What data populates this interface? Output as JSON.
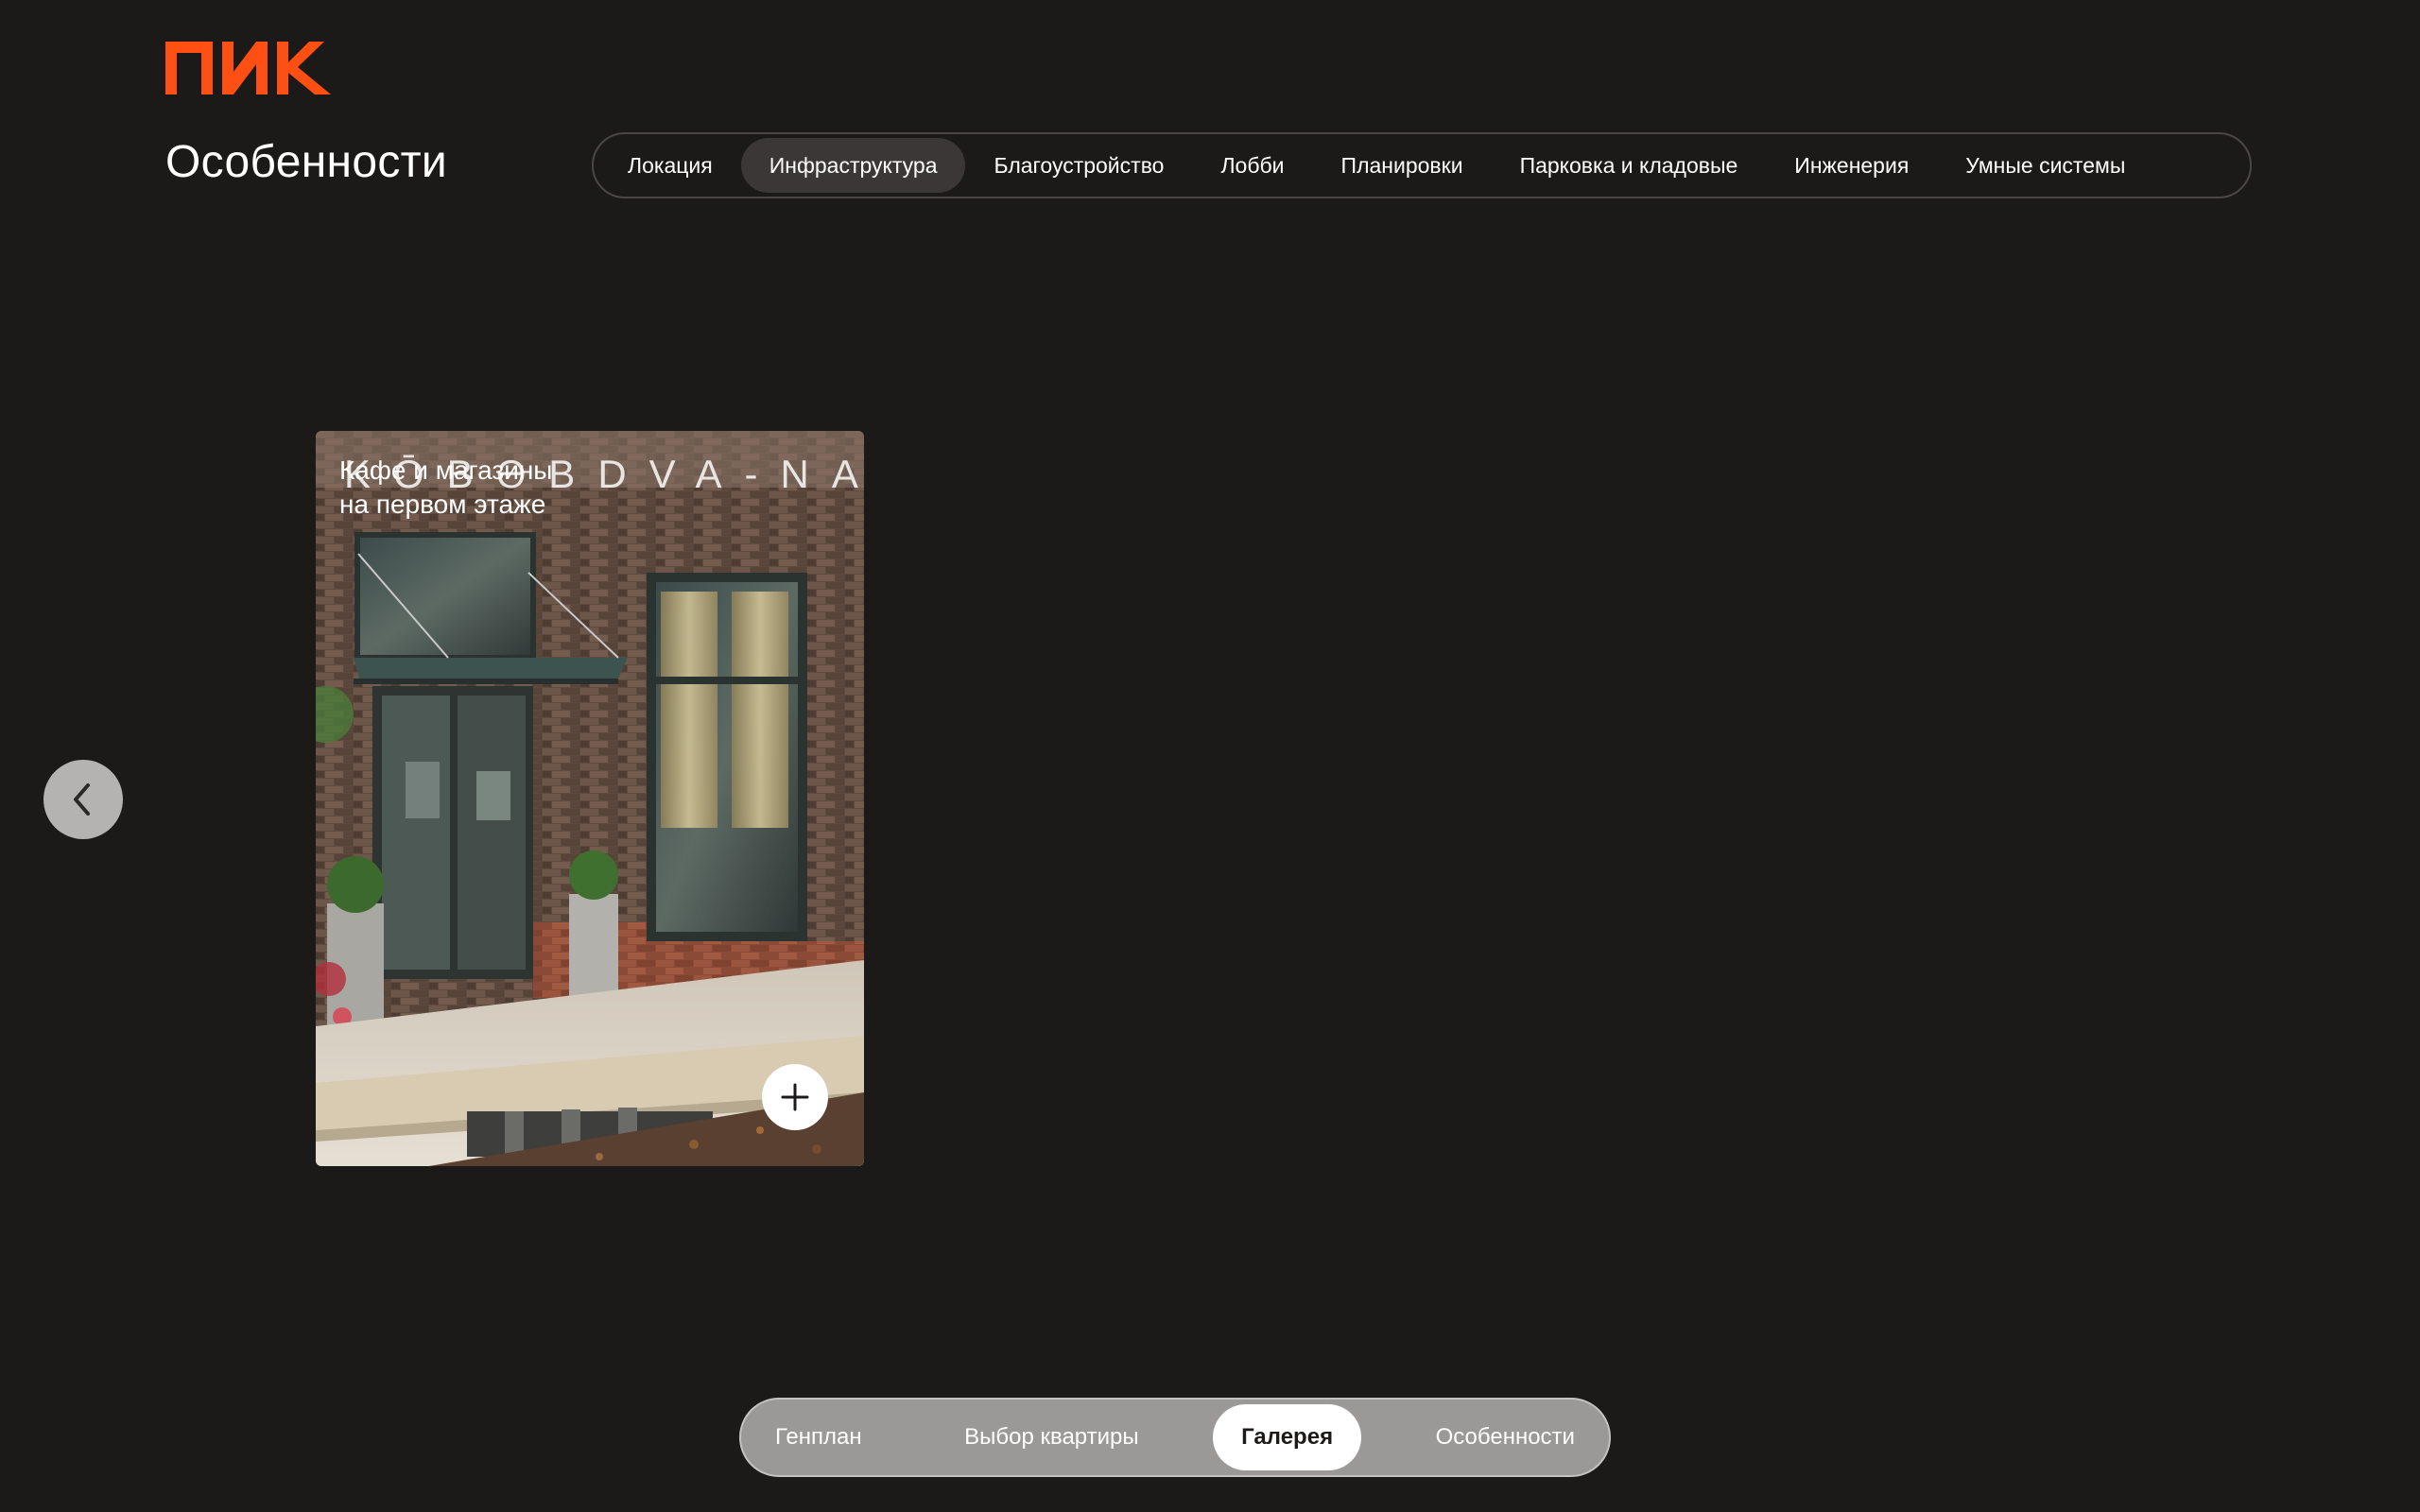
{
  "brand": {
    "logo_text": "ПИК",
    "accent_color": "#ff4f12"
  },
  "header": {
    "title": "Особенности"
  },
  "tabs": {
    "items": [
      {
        "label": "Локация",
        "active": false
      },
      {
        "label": "Инфраструктура",
        "active": true
      },
      {
        "label": "Благоустройство",
        "active": false
      },
      {
        "label": "Лобби",
        "active": false
      },
      {
        "label": "Планировки",
        "active": false
      },
      {
        "label": "Парковка и кладовые",
        "active": false
      },
      {
        "label": "Инженерия",
        "active": false
      },
      {
        "label": "Умные системы",
        "active": false
      }
    ]
  },
  "gallery": {
    "prev_icon": "chevron-left-icon",
    "card": {
      "caption_line1": "Кафе и магазины",
      "caption_line2": "на первом этаже",
      "storefront_sign": "KŌBƏBDVA-NAIL",
      "expand_icon": "plus-icon"
    }
  },
  "bottom_nav": {
    "items": [
      {
        "label": "Генплан",
        "active": false
      },
      {
        "label": "Выбор квартиры",
        "active": false
      },
      {
        "label": "Галерея",
        "active": true
      },
      {
        "label": "Особенности",
        "active": false
      }
    ]
  }
}
